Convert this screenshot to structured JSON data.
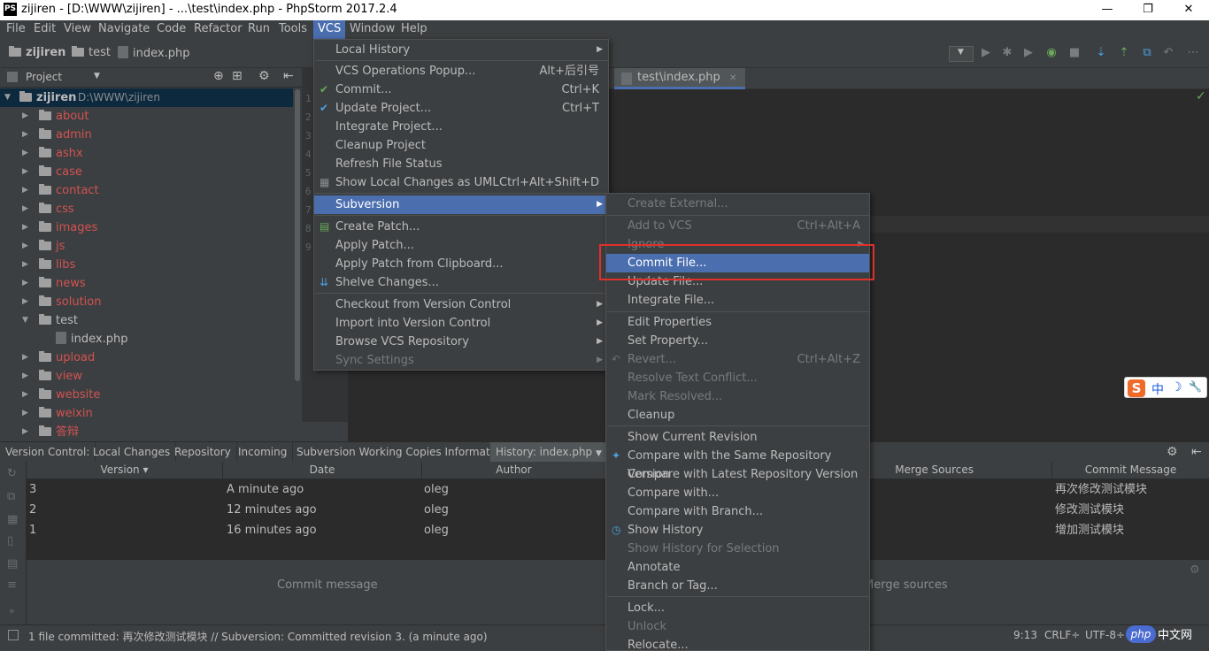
{
  "app": {
    "title": "zijiren - [D:\\WWW\\zijiren] - ...\\test\\index.php - PhpStorm 2017.2.4",
    "icon_text": "PS",
    "win_controls": [
      "—",
      "❐",
      "✕"
    ]
  },
  "menubar": [
    "File",
    "Edit",
    "View",
    "Navigate",
    "Code",
    "Refactor",
    "Run",
    "Tools",
    "VCS",
    "Window",
    "Help"
  ],
  "breadcrumb": {
    "project": "zijiren",
    "folder": "test",
    "file": "index.php"
  },
  "project_panel": {
    "title": "Project",
    "root_name": "zijiren",
    "root_path": "D:\\WWW\\zijiren",
    "folders": [
      "about",
      "admin",
      "ashx",
      "case",
      "contact",
      "css",
      "images",
      "js",
      "libs",
      "news",
      "solution"
    ],
    "open_folder": "test",
    "file": "index.php",
    "folders_after": [
      "upload",
      "view",
      "website",
      "weixin",
      "答辩"
    ]
  },
  "editor": {
    "tab": "test\\index.php",
    "line_numbers": [
      "1",
      "2",
      "3",
      "4",
      "5",
      "6",
      "7",
      "8",
      "9"
    ]
  },
  "vcs_menu": {
    "items": [
      {
        "label": "Local History",
        "shortcut": "",
        "submenu": true
      },
      {
        "label": "VCS Operations Popup...",
        "shortcut": "Alt+后引号"
      },
      {
        "label": "Commit...",
        "shortcut": "Ctrl+K"
      },
      {
        "label": "Update Project...",
        "shortcut": "Ctrl+T"
      },
      {
        "label": "Integrate Project...",
        "shortcut": ""
      },
      {
        "label": "Cleanup Project",
        "shortcut": ""
      },
      {
        "label": "Refresh File Status",
        "shortcut": ""
      },
      {
        "label": "Show Local Changes as UML",
        "shortcut": "Ctrl+Alt+Shift+D"
      },
      {
        "label": "Subversion",
        "shortcut": "",
        "submenu": true
      },
      {
        "label": "Create Patch...",
        "shortcut": ""
      },
      {
        "label": "Apply Patch...",
        "shortcut": ""
      },
      {
        "label": "Apply Patch from Clipboard...",
        "shortcut": ""
      },
      {
        "label": "Shelve Changes...",
        "shortcut": ""
      },
      {
        "label": "Checkout from Version Control",
        "shortcut": "",
        "submenu": true
      },
      {
        "label": "Import into Version Control",
        "shortcut": "",
        "submenu": true
      },
      {
        "label": "Browse VCS Repository",
        "shortcut": "",
        "submenu": true
      },
      {
        "label": "Sync Settings",
        "shortcut": "",
        "submenu": true
      }
    ]
  },
  "svn_menu": {
    "items": [
      {
        "label": "Create External...",
        "shortcut": ""
      },
      {
        "label": "Add to VCS",
        "shortcut": "Ctrl+Alt+A"
      },
      {
        "label": "Ignore",
        "shortcut": "",
        "submenu": true
      },
      {
        "label": "Commit File...",
        "shortcut": ""
      },
      {
        "label": "Update File...",
        "shortcut": ""
      },
      {
        "label": "Integrate File...",
        "shortcut": ""
      },
      {
        "label": "Edit Properties",
        "shortcut": ""
      },
      {
        "label": "Set Property...",
        "shortcut": ""
      },
      {
        "label": "Revert...",
        "shortcut": "Ctrl+Alt+Z"
      },
      {
        "label": "Resolve Text Conflict...",
        "shortcut": ""
      },
      {
        "label": "Mark Resolved...",
        "shortcut": ""
      },
      {
        "label": "Cleanup",
        "shortcut": ""
      },
      {
        "label": "Show Current Revision",
        "shortcut": ""
      },
      {
        "label": "Compare with the Same Repository Version",
        "shortcut": ""
      },
      {
        "label": "Compare with Latest Repository Version",
        "shortcut": ""
      },
      {
        "label": "Compare with...",
        "shortcut": ""
      },
      {
        "label": "Compare with Branch...",
        "shortcut": ""
      },
      {
        "label": "Show History",
        "shortcut": ""
      },
      {
        "label": "Show History for Selection",
        "shortcut": ""
      },
      {
        "label": "Annotate",
        "shortcut": ""
      },
      {
        "label": "Branch or Tag...",
        "shortcut": ""
      },
      {
        "label": "Lock...",
        "shortcut": ""
      },
      {
        "label": "Unlock",
        "shortcut": ""
      },
      {
        "label": "Relocate...",
        "shortcut": ""
      }
    ]
  },
  "vc_panel": {
    "label": "Version Control:",
    "tabs": [
      "Local Changes",
      "Repository",
      "Incoming",
      "Subversion Working Copies Information",
      "History: index.php"
    ],
    "columns": [
      "Version ▾",
      "Date",
      "Author",
      "Merge Sources",
      "Commit Message"
    ],
    "rows": [
      {
        "version": "3",
        "date": "A minute ago",
        "author": "oleg",
        "message": "再次修改测试模块"
      },
      {
        "version": "2",
        "date": "12 minutes ago",
        "author": "oleg",
        "message": "修改测试模块"
      },
      {
        "version": "1",
        "date": "16 minutes ago",
        "author": "oleg",
        "message": "增加测试模块"
      }
    ],
    "commit_message_label": "Commit message",
    "merge_sources_label": "Merge sources"
  },
  "status": {
    "message": "1 file committed: 再次修改测试模块 // Subversion: Committed revision 3. (a minute ago)",
    "position": "9:13",
    "line_sep": "CRLF÷",
    "encoding": "UTF-8÷"
  },
  "ime": {
    "s": "S",
    "zh": "中",
    "moon": "☽",
    "wrench": "🔧"
  },
  "watermark": {
    "php": "php",
    "site": "中文网"
  },
  "colors": {
    "accent": "#4b6eaf",
    "highlight_box": "#e0302a",
    "vcs_red": "#d25252",
    "bg": "#3c3f41",
    "editor_bg": "#2b2b2b"
  }
}
